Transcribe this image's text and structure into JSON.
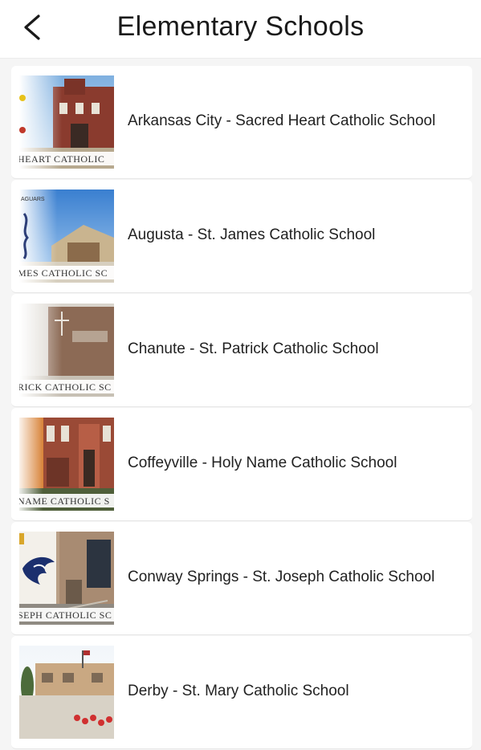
{
  "header": {
    "title": "Elementary Schools",
    "back_icon": "chevron-left-icon"
  },
  "schools": [
    {
      "label": "Arkansas City - Sacred Heart Catholic School",
      "thumb_caption": "HEART CATHOLIC"
    },
    {
      "label": "Augusta - St. James Catholic School",
      "thumb_caption": "MES CATHOLIC SC"
    },
    {
      "label": "Chanute - St. Patrick Catholic School",
      "thumb_caption": "RICK CATHOLIC SC"
    },
    {
      "label": "Coffeyville - Holy Name Catholic School",
      "thumb_caption": "NAME CATHOLIC S"
    },
    {
      "label": "Conway Springs - St. Joseph Catholic School",
      "thumb_caption": "SEPH CATHOLIC SC"
    },
    {
      "label": "Derby - St. Mary Catholic School",
      "thumb_caption": ""
    }
  ],
  "colors": {
    "background": "#f5f5f5",
    "card": "#ffffff",
    "text": "#222222"
  }
}
